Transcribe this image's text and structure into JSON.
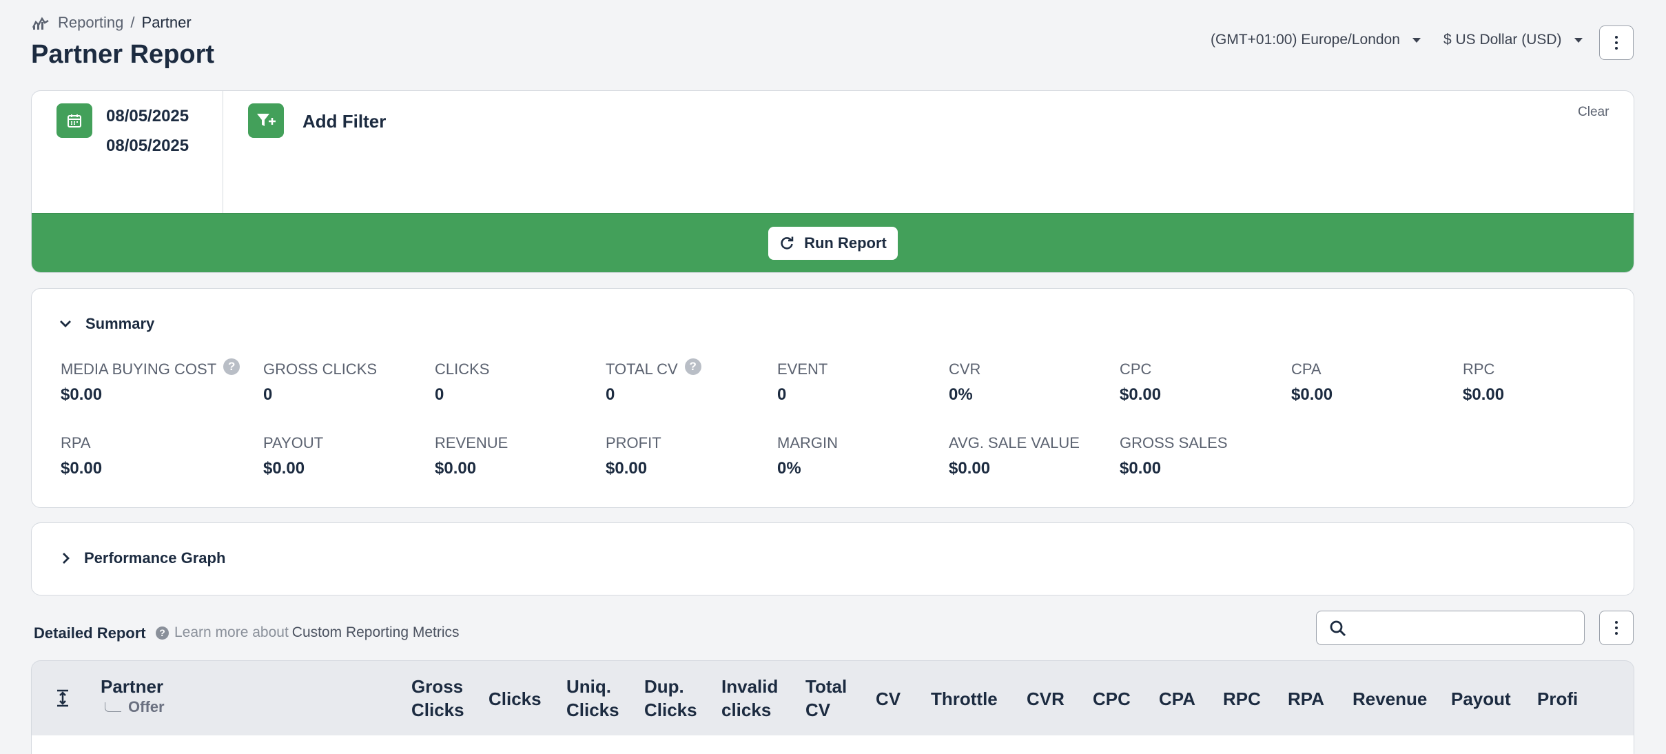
{
  "breadcrumb": {
    "parent": "Reporting",
    "separator": "/",
    "current": "Partner"
  },
  "page_title": "Partner Report",
  "header": {
    "timezone": "(GMT+01:00) Europe/London",
    "currency": "$ US Dollar (USD)"
  },
  "filters": {
    "date_start": "08/05/2025",
    "date_end": "08/05/2025",
    "add_filter_label": "Add Filter",
    "clear_label": "Clear",
    "run_report_label": "Run Report"
  },
  "summary": {
    "title": "Summary",
    "metrics": [
      {
        "label": "MEDIA BUYING COST",
        "value": "$0.00",
        "help": true
      },
      {
        "label": "GROSS CLICKS",
        "value": "0"
      },
      {
        "label": "CLICKS",
        "value": "0"
      },
      {
        "label": "TOTAL CV",
        "value": "0",
        "help": true
      },
      {
        "label": "EVENT",
        "value": "0"
      },
      {
        "label": "CVR",
        "value": "0%"
      },
      {
        "label": "CPC",
        "value": "$0.00"
      },
      {
        "label": "CPA",
        "value": "$0.00"
      },
      {
        "label": "RPC",
        "value": "$0.00"
      },
      {
        "label": "RPA",
        "value": "$0.00"
      },
      {
        "label": "PAYOUT",
        "value": "$0.00"
      },
      {
        "label": "REVENUE",
        "value": "$0.00"
      },
      {
        "label": "PROFIT",
        "value": "$0.00"
      },
      {
        "label": "MARGIN",
        "value": "0%"
      },
      {
        "label": "AVG. SALE VALUE",
        "value": "$0.00"
      },
      {
        "label": "GROSS SALES",
        "value": "$0.00"
      }
    ]
  },
  "graph": {
    "title": "Performance Graph"
  },
  "detailed": {
    "title": "Detailed Report",
    "learn_prefix": "Learn more about",
    "learn_link": "Custom Reporting Metrics",
    "search_placeholder": ""
  },
  "table": {
    "columns": [
      {
        "line1": "Partner",
        "line2": ""
      },
      {
        "line1": "Gross",
        "line2": "Clicks"
      },
      {
        "line1": "Clicks",
        "line2": ""
      },
      {
        "line1": "Uniq.",
        "line2": "Clicks"
      },
      {
        "line1": "Dup.",
        "line2": "Clicks"
      },
      {
        "line1": "Invalid",
        "line2": "clicks"
      },
      {
        "line1": "Total",
        "line2": "CV"
      },
      {
        "line1": "CV",
        "line2": ""
      },
      {
        "line1": "Throttle",
        "line2": ""
      },
      {
        "line1": "CVR",
        "line2": ""
      },
      {
        "line1": "CPC",
        "line2": ""
      },
      {
        "line1": "CPA",
        "line2": ""
      },
      {
        "line1": "RPC",
        "line2": ""
      },
      {
        "line1": "RPA",
        "line2": ""
      },
      {
        "line1": "Revenue",
        "line2": ""
      },
      {
        "line1": "Payout",
        "line2": ""
      },
      {
        "line1": "Profi",
        "line2": ""
      }
    ],
    "partner_sub": "Offer"
  },
  "icons": {
    "breadcrumb": "reporting-chart-icon",
    "date": "calendar-icon",
    "filter": "filter-add-icon",
    "run": "refresh-icon",
    "expand_summary": "chevron-down-icon",
    "expand_graph": "chevron-right-icon",
    "search": "search-icon",
    "kebab": "more-vertical-icon",
    "collapse_rows": "expand-rows-icon"
  },
  "colors": {
    "accent_green": "#43a05a",
    "text_dark": "#1c2b40",
    "muted": "#5b6270"
  }
}
